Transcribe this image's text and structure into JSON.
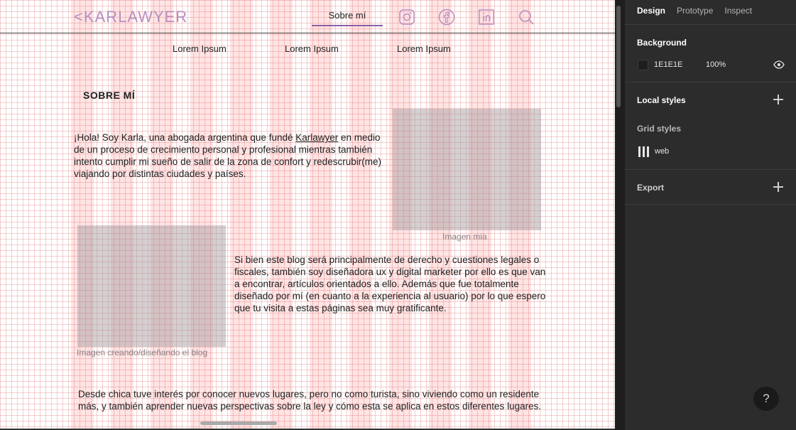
{
  "canvas": {
    "logo": "<KARLAWYER",
    "nav_active": "Sobre mí",
    "submenu": [
      "Lorem Ipsum",
      "Lorem Ipsum",
      "Lorem Ipsum"
    ],
    "heading": "SOBRE MÍ",
    "intro_prefix": "¡Hola! Soy Karla, una abogada argentina que fundé ",
    "intro_link": "Karlawyer",
    "intro_suffix": " en medio de un proceso de crecimiento personal y profesional mientras también intento cumplir mi sueño de salir de la zona de confort y redescrubir(me) viajando por distintas ciudades y países.",
    "image1_caption": "Imagen mia",
    "image2_caption": "Imagen creando/diseñando el blog",
    "para2": "Si bien este blog será principalmente de derecho y cuestiones legales o fiscales, también soy diseñadora ux y digital marketer por ello es que van a encontrar, artículos orientados a ello. Además que fue totalmente diseñado por mí (en cuanto a la experiencia al usuario) por lo que espero que tu visita a estas páginas sea muy gratificante.",
    "para3": "Desde chica tuve interés por conocer nuevos lugares, pero no como turista, sino viviendo como un residente más, y también aprender nuevas perspectivas sobre la ley y cómo esta se aplica en estos diferentes lugares."
  },
  "panel": {
    "tabs": [
      "Design",
      "Prototype",
      "Inspect"
    ],
    "background_label": "Background",
    "background_hex": "1E1E1E",
    "background_opacity": "100%",
    "local_styles_label": "Local styles",
    "grid_styles_label": "Grid styles",
    "grid_style_name": "web",
    "export_label": "Export",
    "help": "?"
  },
  "colors": {
    "logo": "#b58fc2",
    "accent_underline": "#8c5fa3",
    "panel_bg": "#2c2c2c",
    "canvas_bg": "#1e1e1e"
  },
  "icons": [
    "instagram-icon",
    "facebook-icon",
    "linkedin-icon",
    "search-icon",
    "eye-icon",
    "plus-icon",
    "grid-icon",
    "help-icon"
  ]
}
